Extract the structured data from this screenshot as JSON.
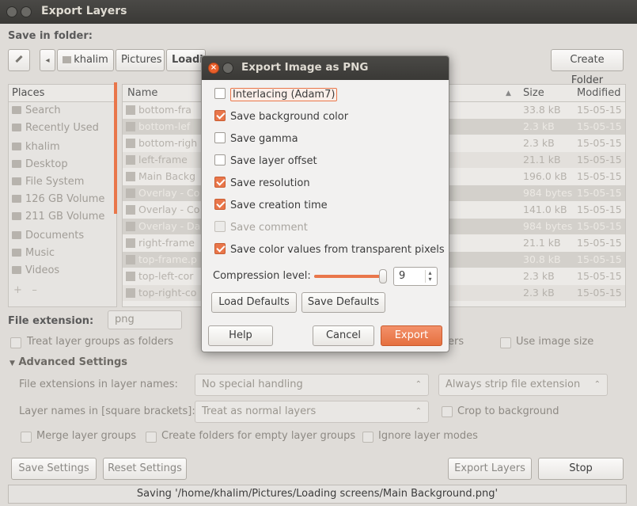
{
  "window": {
    "title": "Export Layers"
  },
  "save_in_folder_label": "Save in folder:",
  "path": [
    "khalim",
    "Pictures",
    "Loadi"
  ],
  "create_folder": "Create Folder",
  "places": {
    "header": "Places",
    "items": [
      {
        "label": "Search",
        "icon": "search-icon"
      },
      {
        "label": "Recently Used",
        "icon": "clock-icon"
      },
      {
        "label": "khalim",
        "icon": "home-folder-icon"
      },
      {
        "label": "Desktop",
        "icon": "desktop-icon"
      },
      {
        "label": "File System",
        "icon": "drive-icon"
      },
      {
        "label": "126 GB Volume",
        "icon": "drive-icon"
      },
      {
        "label": "211 GB Volume",
        "icon": "drive-icon"
      },
      {
        "label": "Documents",
        "icon": "folder-icon"
      },
      {
        "label": "Music",
        "icon": "folder-icon"
      },
      {
        "label": "Videos",
        "icon": "folder-icon"
      }
    ]
  },
  "files": {
    "columns": {
      "name": "Name",
      "size": "Size",
      "modified": "Modified"
    },
    "rows": [
      {
        "name": "bottom-fra",
        "size": "33.8 kB",
        "modified": "15-05-15"
      },
      {
        "name": "bottom-lef",
        "size": "2.3 kB",
        "modified": "15-05-15"
      },
      {
        "name": "bottom-righ",
        "size": "2.3 kB",
        "modified": "15-05-15"
      },
      {
        "name": "left-frame",
        "size": "21.1 kB",
        "modified": "15-05-15"
      },
      {
        "name": "Main Backg",
        "size": "196.0 kB",
        "modified": "15-05-15"
      },
      {
        "name": "Overlay - Co",
        "size": "984 bytes",
        "modified": "15-05-15"
      },
      {
        "name": "Overlay - Co",
        "size": "141.0 kB",
        "modified": "15-05-15"
      },
      {
        "name": "Overlay - Da",
        "size": "984 bytes",
        "modified": "15-05-15"
      },
      {
        "name": "right-frame",
        "size": "21.1 kB",
        "modified": "15-05-15"
      },
      {
        "name": "top-frame.p",
        "size": "30.8 kB",
        "modified": "15-05-15"
      },
      {
        "name": "top-left-cor",
        "size": "2.3 kB",
        "modified": "15-05-15"
      },
      {
        "name": "top-right-co",
        "size": "2.3 kB",
        "modified": "15-05-15"
      }
    ]
  },
  "file_extension": {
    "label": "File extension:",
    "value": "png"
  },
  "treat_groups": "Treat layer groups as folders",
  "ers_fragment": "ers",
  "use_image_size": "Use image size",
  "advanced": {
    "label": "Advanced Settings",
    "ext_label": "File extensions in layer names:",
    "ext_value": "No special handling",
    "strip_value": "Always strip file extension",
    "brackets_label": "Layer names in [square brackets]:",
    "brackets_value": "Treat as normal layers",
    "crop": "Crop to background",
    "merge": "Merge layer groups",
    "create_folders": "Create folders for empty layer groups",
    "ignore_modes": "Ignore layer modes"
  },
  "buttons": {
    "save_settings": "Save Settings",
    "reset_settings": "Reset Settings",
    "export_layers": "Export Layers",
    "stop": "Stop"
  },
  "status": "Saving '/home/khalim/Pictures/Loading screens/Main Background.png'",
  "dialog": {
    "title": "Export Image as PNG",
    "options": [
      {
        "label": "Interlacing (Adam7)",
        "checked": false
      },
      {
        "label": "Save background color",
        "checked": true
      },
      {
        "label": "Save gamma",
        "checked": false
      },
      {
        "label": "Save layer offset",
        "checked": false
      },
      {
        "label": "Save resolution",
        "checked": true
      },
      {
        "label": "Save creation time",
        "checked": true
      },
      {
        "label": "Save comment",
        "checked": false
      },
      {
        "label": "Save color values from transparent pixels",
        "checked": true
      }
    ],
    "compression_label": "Compression level:",
    "compression_value": "9",
    "compression_level": 9,
    "compression_max": 9,
    "load_defaults": "Load Defaults",
    "save_defaults": "Save Defaults",
    "help": "Help",
    "cancel": "Cancel",
    "export": "Export"
  },
  "accent_color": "#e9764a"
}
